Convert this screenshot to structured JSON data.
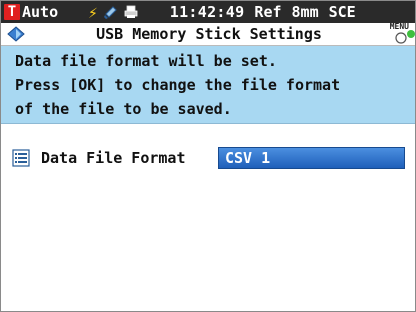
{
  "status_bar": {
    "mode": "Auto",
    "time": "11:42:49",
    "ref": "Ref",
    "aperture": "8mm",
    "specular": "SCE",
    "colors": {
      "t_badge": "#e02020",
      "bolt": "#ffd21f",
      "bar_bg": "#2a2a2a"
    }
  },
  "titlebar": {
    "title": "USB Memory Stick Settings",
    "menu_label": "MENU"
  },
  "message": {
    "line1": "Data file format will be set.",
    "line2": "Press [OK] to change the file format",
    "line3": "of the file to be saved."
  },
  "setting": {
    "label": "Data File Format",
    "value": "CSV 1"
  }
}
